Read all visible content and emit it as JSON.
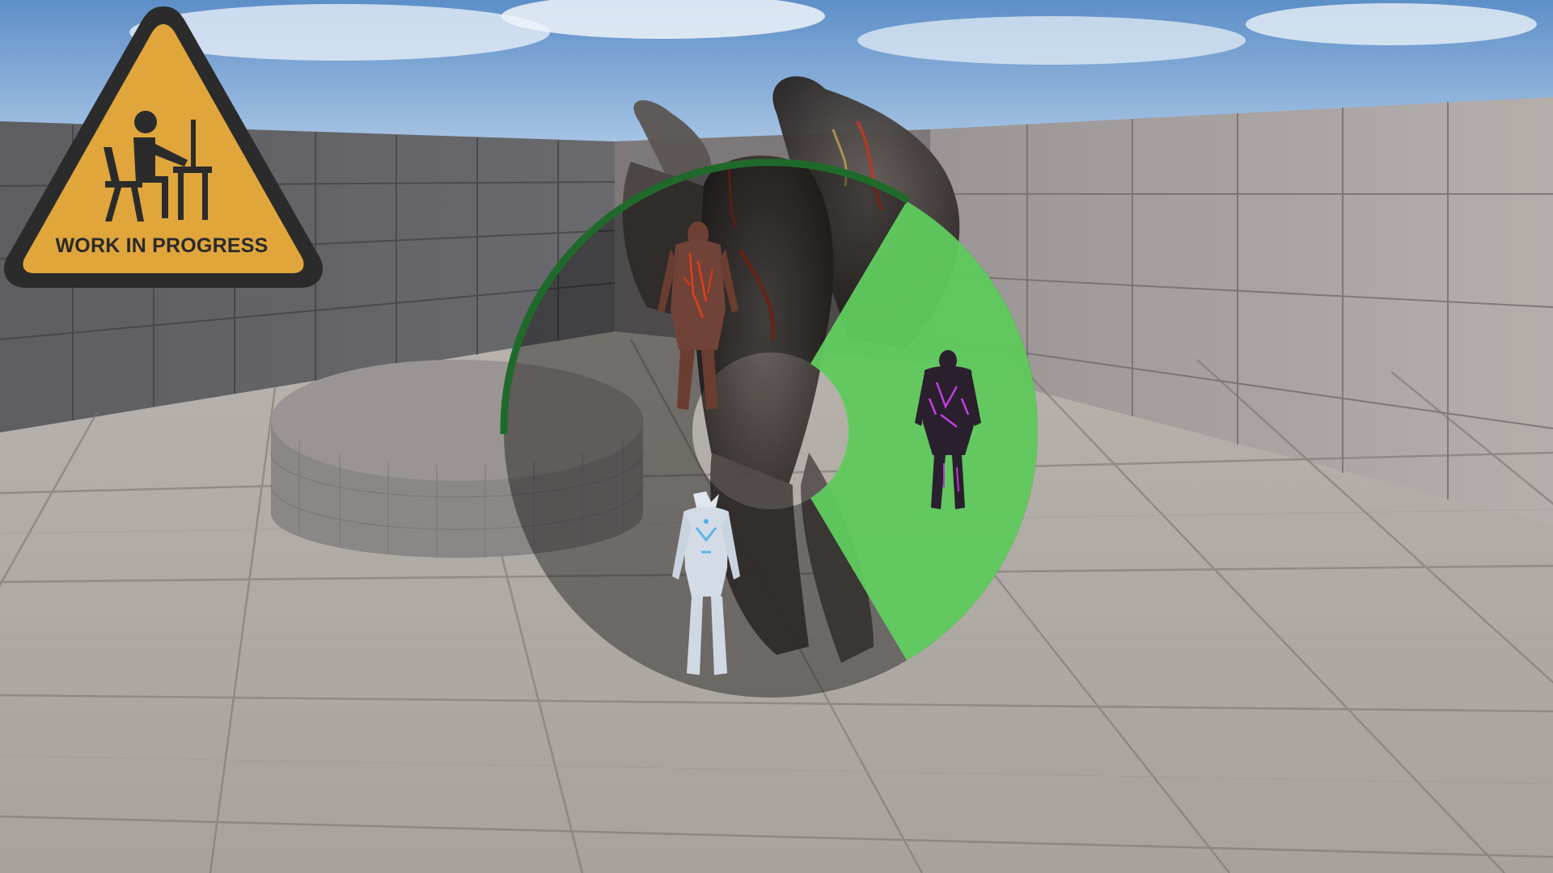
{
  "banner": {
    "label": "WORK IN PROGRESS",
    "colors": {
      "fill": "#e0a63c",
      "border": "#2b2b2b"
    },
    "icon": "person-at-desk-icon"
  },
  "selection_wheel": {
    "slots": [
      {
        "position": "top-left",
        "icon": "lava-golem-character-icon",
        "selected": false
      },
      {
        "position": "right",
        "icon": "dark-purple-brute-character-icon",
        "selected": true
      },
      {
        "position": "bottom",
        "icon": "ice-knight-character-icon",
        "selected": false
      }
    ],
    "colors": {
      "selected_fill": "#62d060",
      "ring": "#1f6a2a",
      "wheel_fill": "#000000"
    }
  }
}
